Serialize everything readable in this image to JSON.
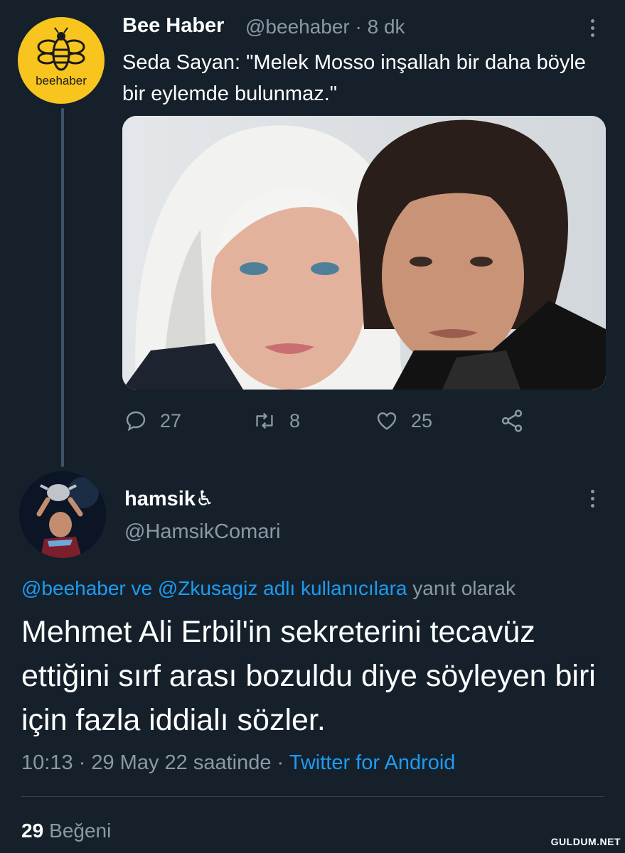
{
  "tweet1": {
    "avatar_text": "beehaber",
    "name": "Bee Haber",
    "handle_time": "@beehaber · 8 dk",
    "text": "Seda Sayan: \"Melek Mosso inşallah bir daha böyle bir eylemde bulunmaz.\"",
    "actions": {
      "replies": "27",
      "retweets": "8",
      "likes": "25"
    }
  },
  "tweet2": {
    "name": "hamsik♿",
    "handle": "@HamsikComari",
    "reply_prefix": "@beehaber ve @Zkusagiz adlı kullanıcılara",
    "reply_suffix": "yanıt olarak",
    "text": "Mehmet Ali Erbil'in sekreterini tecavüz ettiğini sırf arası bozuldu diye söyleyen biri için fazla iddialı sözler.",
    "time": "10:13 · 29 May 22 saatinde ·",
    "source": "Twitter for Android",
    "like_count": "29",
    "like_label": "Beğeni"
  },
  "watermark": "GULDUM.NET",
  "colors": {
    "background": "#15202b",
    "accent": "#1d9bf0",
    "muted": "#8b98a5",
    "brand_yellow": "#f7c51e"
  }
}
